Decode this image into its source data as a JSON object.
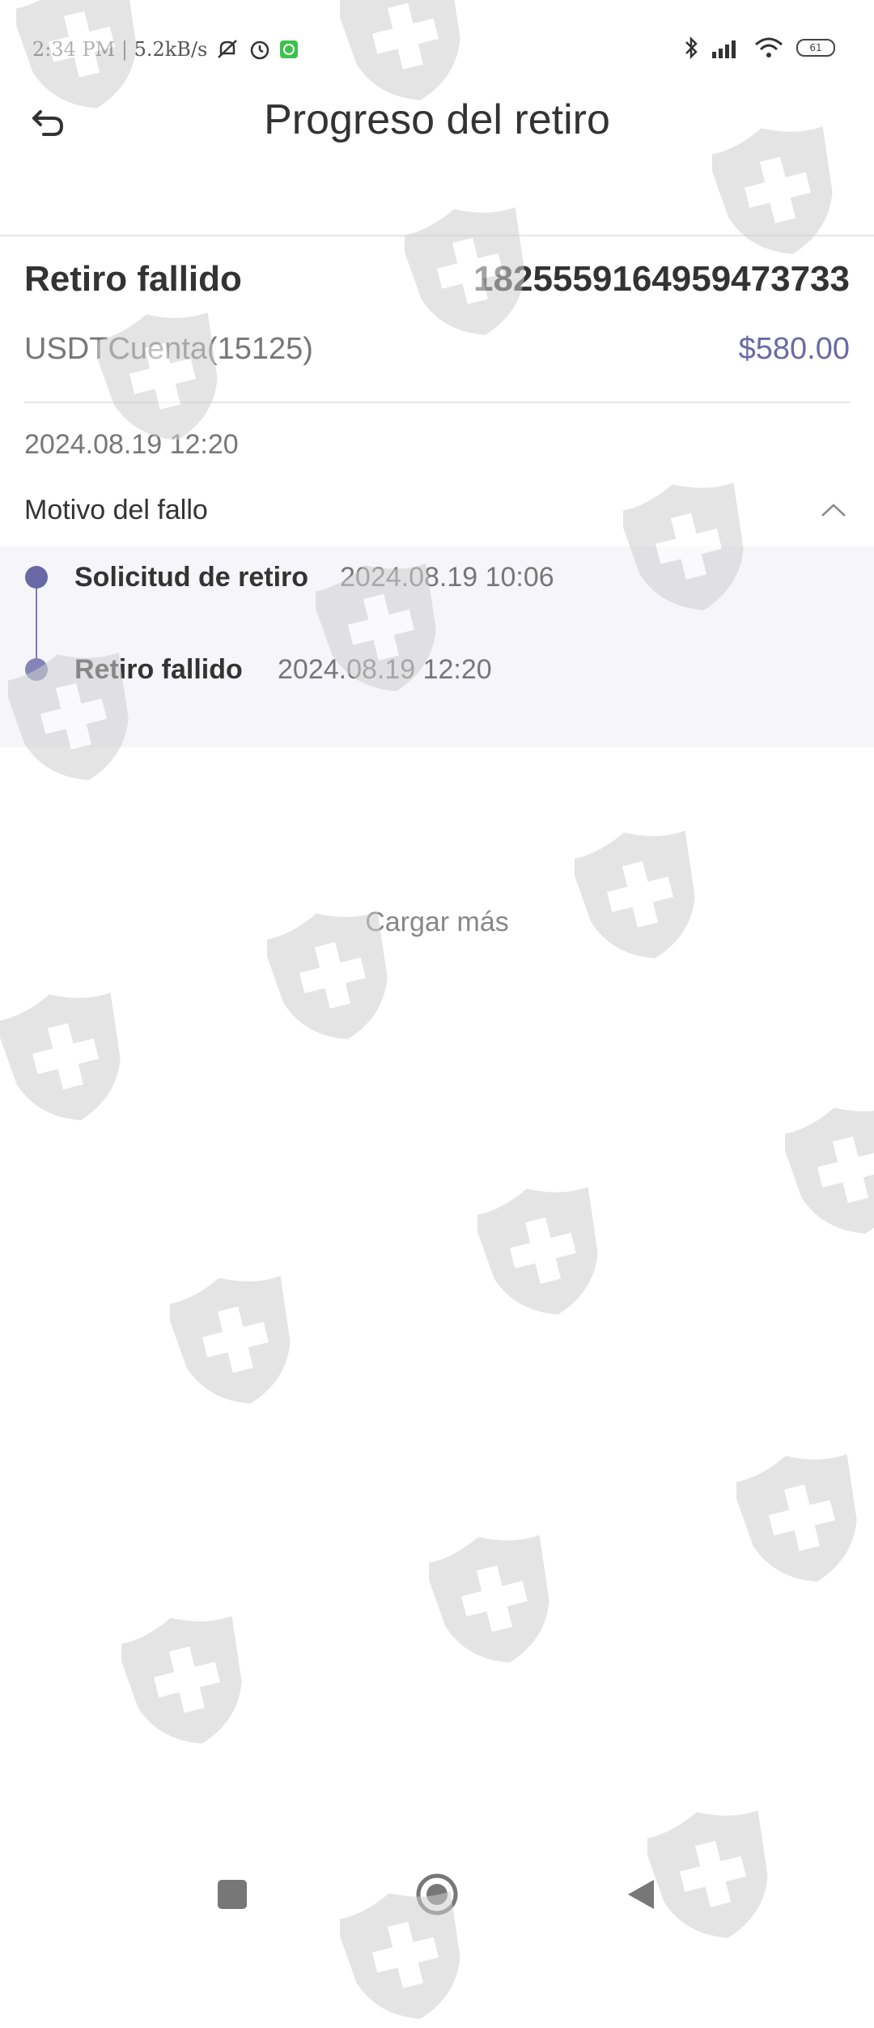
{
  "status_bar": {
    "time_speed": "2:34 PM | 5.2kB/s",
    "battery_level": "61",
    "icons": [
      "mute-icon",
      "alarm-icon",
      "whatsapp-icon",
      "bluetooth-icon",
      "signal-icon",
      "wifi-icon",
      "battery-icon"
    ]
  },
  "header": {
    "title": "Progreso del retiro",
    "back_icon": "back-arrow-icon"
  },
  "summary": {
    "status": "Retiro fallido",
    "order_id": "1825559164959473733",
    "account": "USDTCuenta(15125)",
    "amount": "$580.00",
    "date": "2024.08.19 12:20"
  },
  "reason": {
    "label": "Motivo del fallo",
    "expanded": true
  },
  "timeline": {
    "items": [
      {
        "label": "Solicitud de retiro",
        "time": "2024.08.19 10:06"
      },
      {
        "label": "Retiro fallido",
        "time": "2024.08.19 12:20"
      }
    ]
  },
  "load_more": "Cargar más",
  "nav": {
    "icons": [
      "recents-square-icon",
      "home-circle-icon",
      "back-triangle-icon"
    ]
  },
  "colors": {
    "accent": "#6a6aa6",
    "timeline_bg": "#f5f5fa",
    "divider": "#e6e6e6"
  }
}
